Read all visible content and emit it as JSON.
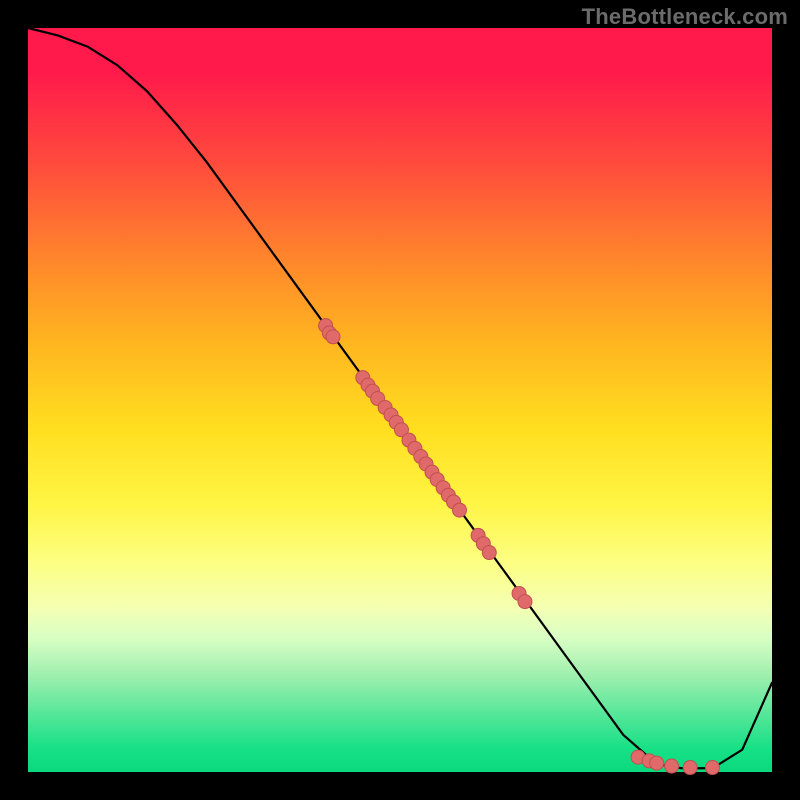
{
  "watermark": "TheBottleneck.com",
  "colors": {
    "dot_fill": "#e06a6a",
    "dot_stroke": "#c24f4f",
    "curve": "#000000"
  },
  "chart_data": {
    "type": "line",
    "title": "",
    "xlabel": "",
    "ylabel": "",
    "xlim": [
      0,
      100
    ],
    "ylim": [
      0,
      100
    ],
    "grid": false,
    "series": [
      {
        "name": "curve",
        "x": [
          0,
          4,
          8,
          12,
          16,
          20,
          24,
          28,
          32,
          36,
          40,
          44,
          48,
          52,
          56,
          60,
          64,
          68,
          72,
          76,
          80,
          84,
          86,
          88,
          92,
          96,
          100
        ],
        "y": [
          100,
          99,
          97.5,
          95,
          91.5,
          87,
          82,
          76.5,
          71,
          65.5,
          60,
          54.5,
          49,
          43.5,
          38,
          32.5,
          27,
          21.5,
          16,
          10.5,
          5,
          1.5,
          0.7,
          0.5,
          0.5,
          3,
          12
        ]
      }
    ],
    "points": [
      {
        "x": 40,
        "y": 60
      },
      {
        "x": 40.5,
        "y": 59
      },
      {
        "x": 41,
        "y": 58.5
      },
      {
        "x": 45,
        "y": 53
      },
      {
        "x": 45.7,
        "y": 52
      },
      {
        "x": 46.3,
        "y": 51.2
      },
      {
        "x": 47,
        "y": 50.2
      },
      {
        "x": 48,
        "y": 49
      },
      {
        "x": 48.8,
        "y": 48
      },
      {
        "x": 49.5,
        "y": 47
      },
      {
        "x": 50.2,
        "y": 46
      },
      {
        "x": 51.2,
        "y": 44.6
      },
      {
        "x": 52,
        "y": 43.5
      },
      {
        "x": 52.8,
        "y": 42.4
      },
      {
        "x": 53.5,
        "y": 41.4
      },
      {
        "x": 54.3,
        "y": 40.3
      },
      {
        "x": 55,
        "y": 39.3
      },
      {
        "x": 55.8,
        "y": 38.2
      },
      {
        "x": 56.5,
        "y": 37.2
      },
      {
        "x": 57.2,
        "y": 36.3
      },
      {
        "x": 58,
        "y": 35.2
      },
      {
        "x": 60.5,
        "y": 31.8
      },
      {
        "x": 61.2,
        "y": 30.7
      },
      {
        "x": 62,
        "y": 29.5
      },
      {
        "x": 66,
        "y": 24
      },
      {
        "x": 66.8,
        "y": 22.9
      },
      {
        "x": 82,
        "y": 2
      },
      {
        "x": 83.5,
        "y": 1.5
      },
      {
        "x": 84.5,
        "y": 1.2
      },
      {
        "x": 86.5,
        "y": 0.8
      },
      {
        "x": 89,
        "y": 0.6
      },
      {
        "x": 92,
        "y": 0.6
      }
    ],
    "dot_radius": 7
  }
}
